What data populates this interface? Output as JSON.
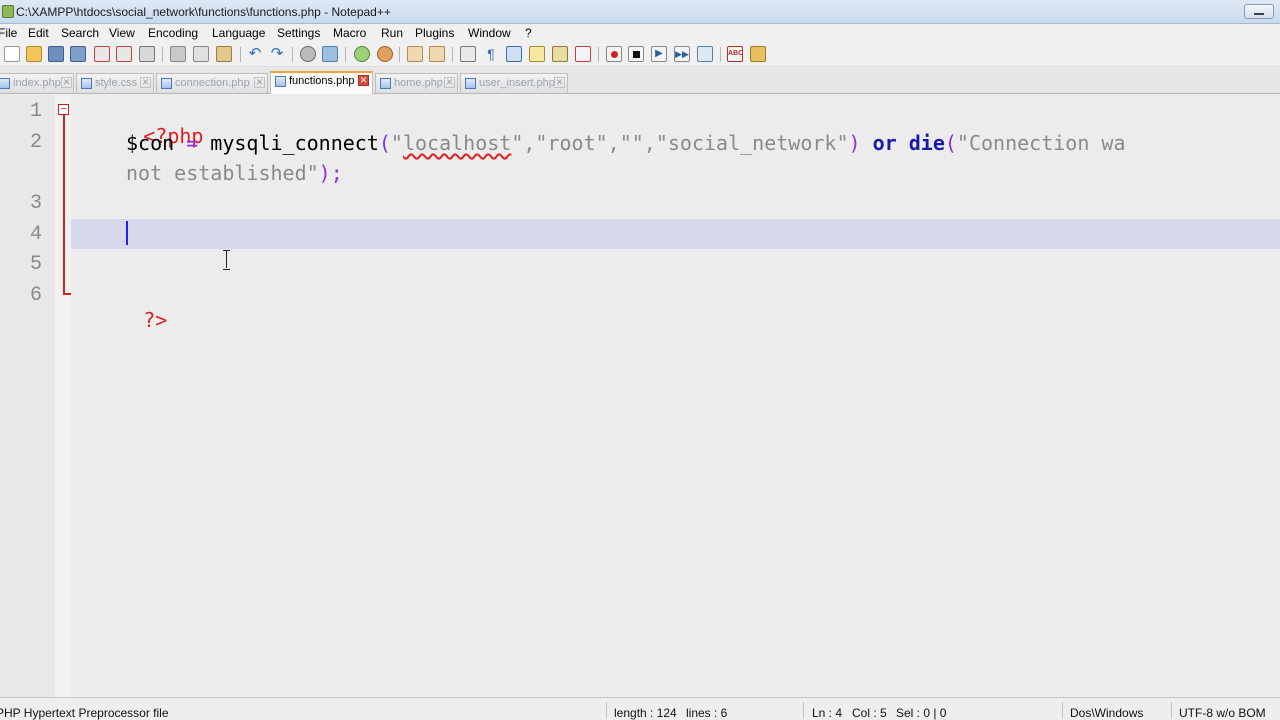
{
  "window": {
    "title": "C:\\XAMPP\\htdocs\\social_network\\functions\\functions.php - Notepad++"
  },
  "menu": [
    "File",
    "Edit",
    "Search",
    "View",
    "Encoding",
    "Language",
    "Settings",
    "Macro",
    "Run",
    "Plugins",
    "Window",
    "?"
  ],
  "tabs": [
    {
      "label": "index.php",
      "active": false
    },
    {
      "label": "style.css",
      "active": false
    },
    {
      "label": "connection.php",
      "active": false
    },
    {
      "label": "functions.php",
      "active": true
    },
    {
      "label": "home.php",
      "active": false
    },
    {
      "label": "user_insert.php",
      "active": false
    }
  ],
  "editor": {
    "line_numbers": [
      "1",
      "2",
      "3",
      "4",
      "5",
      "6"
    ],
    "code": {
      "line1_open_tag": "<?php",
      "line2_var": "$con",
      "line2_eq": " = ",
      "line2_fn": "mysqli_connect",
      "line2_paren_open": "(",
      "line2_q1": "\"",
      "line2_host": "localhost",
      "line2_args": "\",\"root\",\"\",\"social_network\"",
      "line2_paren_close": ")",
      "line2_or": "or",
      "line2_die": "die",
      "line2_die_open": "(",
      "line2_msg": "\"Connection wa",
      "line2_wrap": "not established\"",
      "line2_end": ");",
      "line6_close_tag": "?>"
    },
    "current_line": 4
  },
  "status": {
    "file_type": "PHP Hypertext Preprocessor file",
    "length": "length : 124",
    "lines": "lines : 6",
    "ln": "Ln : 4",
    "col": "Col : 5",
    "sel": "Sel : 0 | 0",
    "eol": "Dos\\Windows",
    "encoding": "UTF-8 w/o BOM"
  },
  "colors": {
    "php_tag": "#e02020",
    "keyword": "#1a1aa8",
    "string": "#8a8a8a",
    "operator": "#8f2fe0",
    "current_line_bg": "#d8d8ec",
    "active_tab_accent": "#f2a33a"
  }
}
